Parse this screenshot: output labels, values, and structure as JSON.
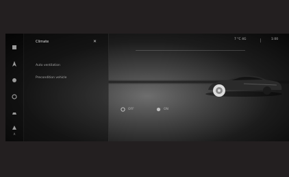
{
  "panel": {
    "title": "Climate",
    "close_symbol": "✕",
    "items": [
      "Auto ventilation",
      "Precondition vehicle"
    ]
  },
  "status_bar": {
    "left": "7 °C  4G",
    "time": "1:00"
  },
  "controls": {
    "left_label": "OFF",
    "right_label": "ON"
  },
  "nav": {
    "icons": [
      "home-icon",
      "navigation-icon",
      "media-icon",
      "phone-icon",
      "car-icon",
      "apps-icon"
    ],
    "bottom_label": "A"
  },
  "colors": {
    "frame": "#231f20",
    "screen": "#0b0b0b",
    "text": "#cfcfcf"
  }
}
